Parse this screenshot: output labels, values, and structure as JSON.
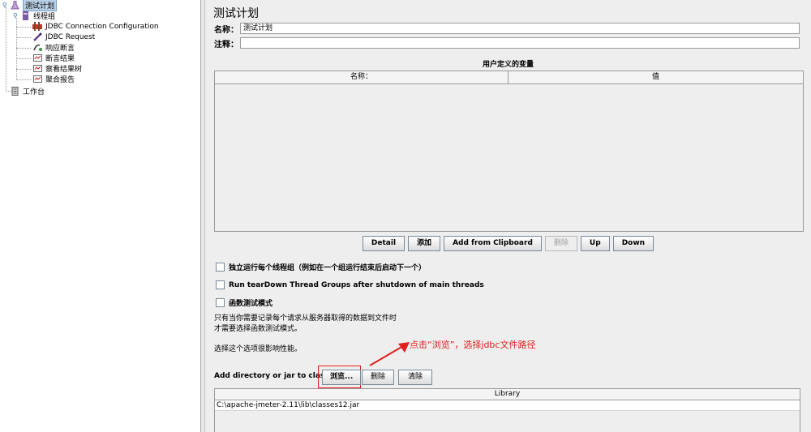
{
  "tree": {
    "items": [
      {
        "label": "测试计划",
        "icon": "flask-icon"
      },
      {
        "label": "线程组",
        "icon": "thread-group-icon"
      },
      {
        "label": "JDBC Connection Configuration",
        "icon": "config-icon"
      },
      {
        "label": "JDBC Request",
        "icon": "sampler-icon"
      },
      {
        "label": "响应断言",
        "icon": "assertion-icon"
      },
      {
        "label": "断言结果",
        "icon": "listener-icon"
      },
      {
        "label": "察看结果树",
        "icon": "listener-icon"
      },
      {
        "label": "聚合报告",
        "icon": "listener-icon"
      },
      {
        "label": "工作台",
        "icon": "workbench-icon"
      }
    ]
  },
  "panel": {
    "title": "测试计划",
    "name_label": "名称：",
    "name_value": "测试计划",
    "comment_label": "注释：",
    "comment_value": "",
    "vars_title": "用户定义的变量",
    "vars_columns": [
      "名称：",
      "值"
    ],
    "buttons": [
      "Detail",
      "添加",
      "Add from Clipboard",
      "删除",
      "Up",
      "Down"
    ],
    "checkboxes": [
      "独立运行每个线程组（例如在一个组运行结束后启动下一个）",
      "Run tearDown Thread Groups after shutdown of main threads",
      "函数测试模式"
    ],
    "note_lines": [
      "只有当你需要记录每个请求从服务器取得的数据到文件时",
      "才需要选择函数测试模式。",
      "选择这个选项很影响性能。"
    ],
    "classpath_label": "Add directory or jar to classpath",
    "classpath_buttons": [
      "浏览...",
      "删除",
      "清除"
    ],
    "library_header": "Library",
    "library_rows": [
      "C:\\apache-jmeter-2.11\\lib\\classes12.jar"
    ]
  },
  "annotation": {
    "text": "点击“浏览”，选择jdbc文件路径",
    "color": "#e0201c"
  }
}
